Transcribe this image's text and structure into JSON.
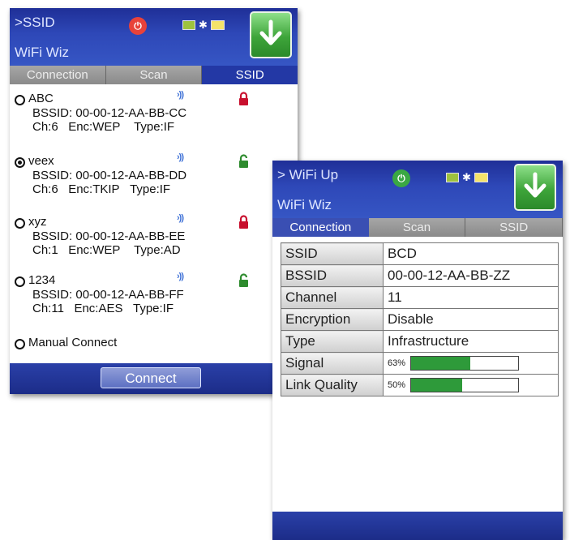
{
  "left_screen": {
    "title": ">SSID",
    "subtitle": "WiFi Wiz",
    "tabs": [
      {
        "label": "Connection",
        "active": false
      },
      {
        "label": "Scan",
        "active": false
      },
      {
        "label": "SSID",
        "active": true
      }
    ],
    "networks": [
      {
        "name": "ABC",
        "bssid": "BSSID: 00-00-12-AA-BB-CC",
        "ch": "Ch:6",
        "enc": "Enc:WEP",
        "type": "Type:IF",
        "selected": false,
        "lock_color": "#c8102e",
        "locked": true
      },
      {
        "name": "veex",
        "bssid": "BSSID: 00-00-12-AA-BB-DD",
        "ch": "Ch:6",
        "enc": "Enc:TKIP",
        "type": "Type:IF",
        "selected": true,
        "lock_color": "#2e8b2e",
        "locked": false
      },
      {
        "name": "xyz",
        "bssid": "BSSID: 00-00-12-AA-BB-EE",
        "ch": "Ch:1",
        "enc": "Enc:WEP",
        "type": "Type:AD",
        "selected": false,
        "lock_color": "#c8102e",
        "locked": true
      },
      {
        "name": "1234",
        "bssid": "BSSID: 00-00-12-AA-BB-FF",
        "ch": "Ch:11",
        "enc": "Enc:AES",
        "type": "Type:IF",
        "selected": false,
        "lock_color": "#2e8b2e",
        "locked": false
      }
    ],
    "manual_connect": "Manual Connect",
    "connect_button": "Connect",
    "power_icon_color": "#e8423a",
    "signal_icon": "wifi-signal-icon"
  },
  "right_screen": {
    "title": "> WiFi Up",
    "subtitle": "WiFi Wiz",
    "tabs": [
      {
        "label": "Connection",
        "active": true
      },
      {
        "label": "Scan",
        "active": false
      },
      {
        "label": "SSID",
        "active": false
      }
    ],
    "details": [
      {
        "key": "SSID",
        "value": "BCD"
      },
      {
        "key": "BSSID",
        "value": "00-00-12-AA-BB-ZZ"
      },
      {
        "key": "Channel",
        "value": "11"
      },
      {
        "key": "Encryption",
        "value": "Disable"
      },
      {
        "key": "Type",
        "value": "Infrastructure"
      }
    ],
    "signal": {
      "key": "Signal",
      "label": "63%",
      "level": 0.55
    },
    "link_quality": {
      "key": "Link Quality",
      "label": "50%",
      "level": 0.48
    },
    "power_icon_color": "#3aa843"
  },
  "colors": {
    "header_blue": "#2e48b8",
    "accent_green": "#2e9a3a"
  }
}
